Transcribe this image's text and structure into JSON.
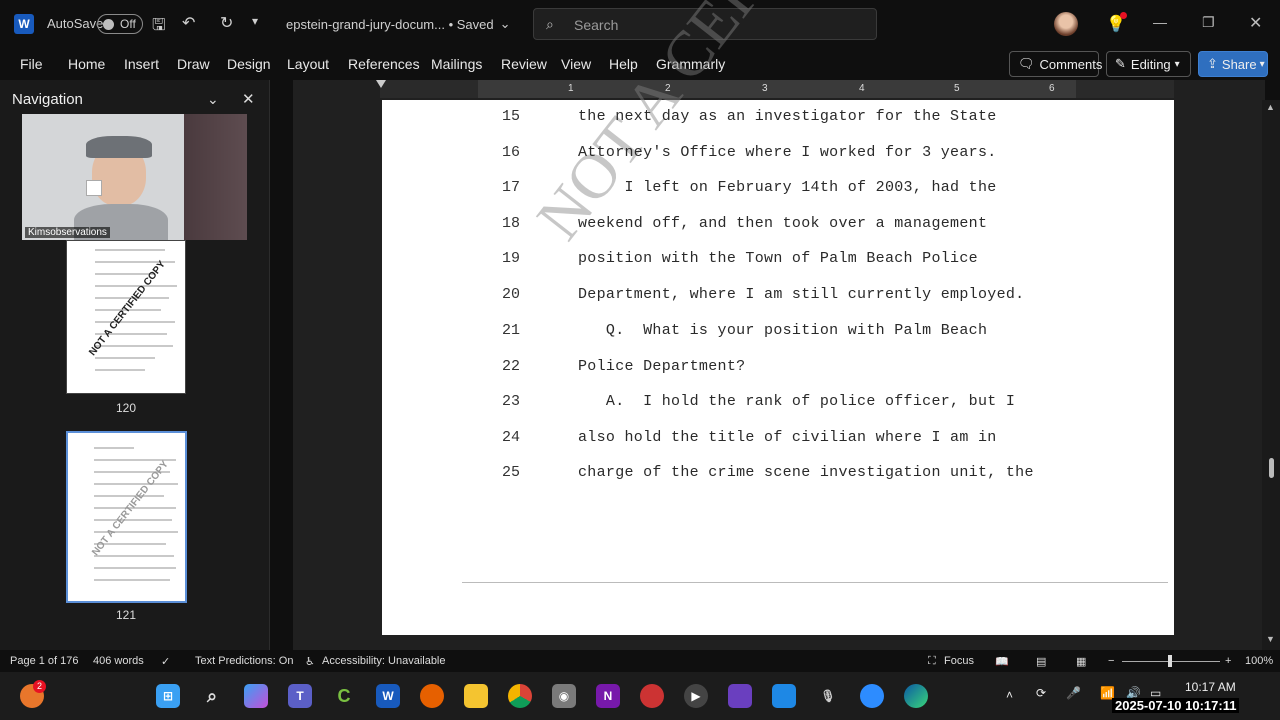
{
  "titlebar": {
    "app_letter": "W",
    "autosave_label": "AutoSave",
    "autosave_state": "Off",
    "doc_title": "epstein-grand-jury-docum... • Saved",
    "search_placeholder": "Search"
  },
  "menu": {
    "items": [
      "File",
      "Home",
      "Insert",
      "Draw",
      "Design",
      "Layout",
      "References",
      "Mailings",
      "Review",
      "View",
      "Help",
      "Grammarly"
    ],
    "comments_label": "Comments",
    "editing_label": "Editing",
    "share_label": "Share"
  },
  "navigation": {
    "title": "Navigation",
    "webcam_name": "Kimsobservations",
    "thumbnails": [
      {
        "page_label": "120",
        "stamp": "NOT A CERTIFIED COPY"
      },
      {
        "page_label": "121",
        "stamp": "NOT A CERTIFIED COPY"
      }
    ]
  },
  "ruler": {
    "marks": [
      "1",
      "2",
      "3",
      "4",
      "5",
      "6"
    ]
  },
  "document": {
    "watermark": "NOT A CER",
    "lines": [
      {
        "num": "15",
        "text": "the next day as an investigator for the State"
      },
      {
        "num": "16",
        "text": "Attorney's Office where I worked for 3 years."
      },
      {
        "num": "17",
        "text": "     I left on February 14th of 2003, had the"
      },
      {
        "num": "18",
        "text": "weekend off, and then took over a management"
      },
      {
        "num": "19",
        "text": "position with the Town of Palm Beach Police"
      },
      {
        "num": "20",
        "text": "Department, where I am still currently employed."
      },
      {
        "num": "21",
        "text": "   Q.  What is your position with Palm Beach"
      },
      {
        "num": "22",
        "text": "Police Department?"
      },
      {
        "num": "23",
        "text": "   A.  I hold the rank of police officer, but I"
      },
      {
        "num": "24",
        "text": "also hold the title of civilian where I am in"
      },
      {
        "num": "25",
        "text": "charge of the crime scene investigation unit, the"
      }
    ]
  },
  "status": {
    "page": "Page 1 of 176",
    "words": "406 words",
    "predictions": "Text Predictions: On",
    "accessibility": "Accessibility: Unavailable",
    "focus": "Focus",
    "zoom": "100%"
  },
  "taskbar": {
    "notification_count": "2",
    "time": "10:17 AM",
    "datetime_overlay": "2025-07-10 10:17:11"
  }
}
